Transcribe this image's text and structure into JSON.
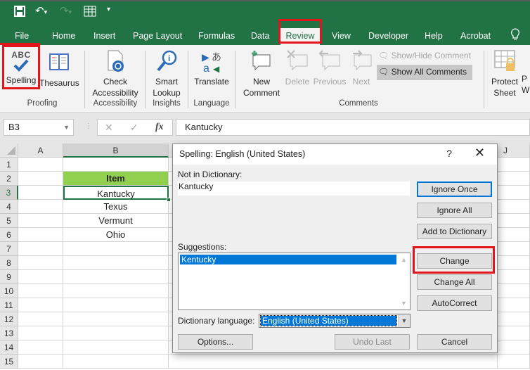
{
  "qat": {
    "save_icon": "save-icon",
    "undo_icon": "undo-icon",
    "redo_icon": "redo-icon",
    "form_icon": "form-icon",
    "customize_icon": "customize-qat-icon"
  },
  "tabs": [
    "File",
    "Home",
    "Insert",
    "Page Layout",
    "Formulas",
    "Data",
    "Review",
    "View",
    "Developer",
    "Help",
    "Acrobat"
  ],
  "active_tab": "Review",
  "tell_me_icon": "lightbulb-icon",
  "ribbon": {
    "proofing": {
      "label": "Proofing",
      "spelling": "Spelling",
      "thesaurus": "Thesaurus",
      "abc": "ABC"
    },
    "accessibility": {
      "label": "Accessibility",
      "check_line1": "Check",
      "check_line2": "Accessibility"
    },
    "insights": {
      "label": "Insights",
      "smart_line1": "Smart",
      "smart_line2": "Lookup"
    },
    "language": {
      "label": "Language",
      "translate": "Translate"
    },
    "comments": {
      "label": "Comments",
      "new_line1": "New",
      "new_line2": "Comment",
      "delete": "Delete",
      "previous": "Previous",
      "next": "Next",
      "show_hide": "Show/Hide Comment",
      "show_all": "Show All Comments"
    },
    "protect": {
      "sheet_line1": "Protect",
      "sheet_line2": "Sheet",
      "wb_line1": "P",
      "wb_line2": "W"
    }
  },
  "formula_bar": {
    "name_box": "B3",
    "cancel": "✕",
    "enter": "✓",
    "fx": "fx",
    "value": "Kantucky"
  },
  "grid": {
    "columns": [
      "A",
      "B",
      "J"
    ],
    "rows": [
      "1",
      "2",
      "3",
      "4",
      "5",
      "6",
      "7",
      "8",
      "9",
      "10",
      "11",
      "12",
      "13",
      "14",
      "15"
    ],
    "cells": {
      "B2": "Item",
      "B3": "Kantucky",
      "B4": "Texus",
      "B5": "Vermunt",
      "B6": "Ohio"
    },
    "header_fill": "#92d050",
    "active_cell": "B3"
  },
  "dialog": {
    "title": "Spelling: English (United States)",
    "help": "?",
    "close": "✕",
    "not_in_dict_label": "Not in Dictionary:",
    "not_in_dict_value": "Kantucky",
    "suggestions_label": "Suggestions:",
    "suggestions": [
      "Kentucky"
    ],
    "dict_lang_label": "Dictionary language:",
    "dict_lang_value": "English (United States)",
    "buttons": {
      "ignore_once": "Ignore Once",
      "ignore_all": "Ignore All",
      "add_to_dictionary": "Add to Dictionary",
      "change": "Change",
      "change_all": "Change All",
      "autocorrect": "AutoCorrect",
      "options": "Options...",
      "undo_last": "Undo Last",
      "cancel": "Cancel"
    }
  }
}
